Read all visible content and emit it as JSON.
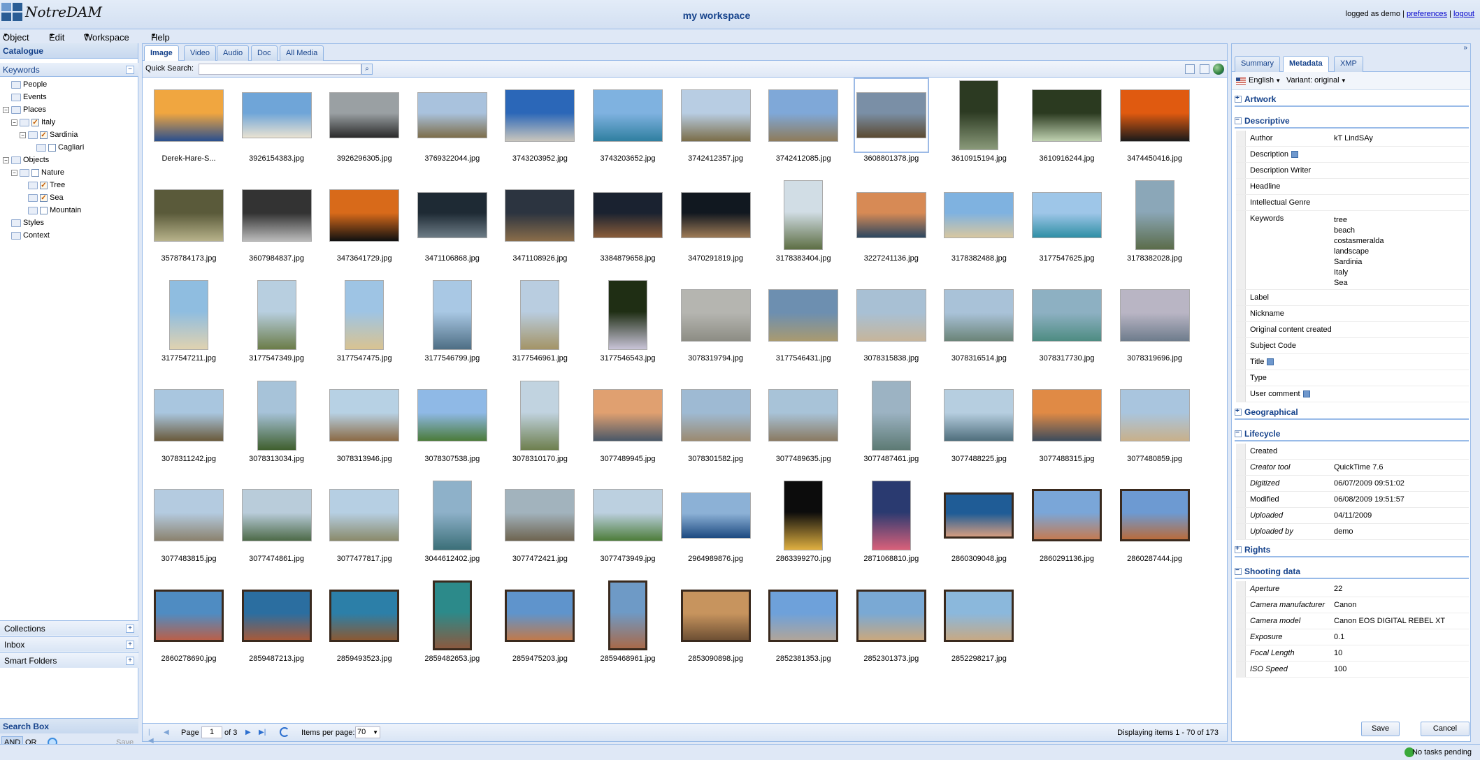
{
  "app": {
    "name": "NotreDAM",
    "workspace_title": "my workspace",
    "logged_as": "logged as demo",
    "preferences": "preferences",
    "logout": "logout",
    "sep": "|"
  },
  "menu": [
    "Object",
    "Edit",
    "Workspace",
    "Help"
  ],
  "catalogue": {
    "title": "Catalogue",
    "keywords": "Keywords",
    "tree": [
      {
        "label": "People",
        "level": 0,
        "toggle": "",
        "check": null
      },
      {
        "label": "Events",
        "level": 0,
        "toggle": "",
        "check": null
      },
      {
        "label": "Places",
        "level": 0,
        "toggle": "−",
        "check": null
      },
      {
        "label": "Italy",
        "level": 1,
        "toggle": "−",
        "check": true
      },
      {
        "label": "Sardinia",
        "level": 2,
        "toggle": "−",
        "check": true
      },
      {
        "label": "Cagliari",
        "level": 3,
        "toggle": "",
        "check": false
      },
      {
        "label": "Objects",
        "level": 0,
        "toggle": "−",
        "check": null
      },
      {
        "label": "Nature",
        "level": 1,
        "toggle": "−",
        "check": false
      },
      {
        "label": "Tree",
        "level": 2,
        "toggle": "",
        "check": true
      },
      {
        "label": "Sea",
        "level": 2,
        "toggle": "",
        "check": true
      },
      {
        "label": "Mountain",
        "level": 2,
        "toggle": "",
        "check": false
      },
      {
        "label": "Styles",
        "level": 0,
        "toggle": "",
        "check": null
      },
      {
        "label": "Context",
        "level": 0,
        "toggle": "",
        "check": null
      }
    ]
  },
  "accordions": [
    "Collections",
    "Inbox",
    "Smart Folders"
  ],
  "search_box": {
    "title": "Search Box",
    "and": "AND",
    "or": "OR",
    "save": "Save"
  },
  "media_tabs": [
    "Image",
    "Video",
    "Audio",
    "Doc",
    "All Media"
  ],
  "quick_search": {
    "label": "Quick Search:",
    "value": ""
  },
  "items": [
    {
      "n": "Derek-Hare-S...",
      "t": "w",
      "c": "#f0a640",
      "c2": "#2a4f8e"
    },
    {
      "n": "3926154383.jpg",
      "t": "w2",
      "c": "#6fa5d8",
      "c2": "#e9e2d2"
    },
    {
      "n": "3926296305.jpg",
      "t": "w2",
      "c": "#9aa0a3",
      "c2": "#2a2a2a"
    },
    {
      "n": "3769322044.jpg",
      "t": "w2",
      "c": "#a9c2dd",
      "c2": "#7d6d4a"
    },
    {
      "n": "3743203952.jpg",
      "t": "w",
      "c": "#2b67b8",
      "c2": "#c9c6bd"
    },
    {
      "n": "3743203652.jpg",
      "t": "w",
      "c": "#7fb2e0",
      "c2": "#2f7fa0"
    },
    {
      "n": "3742412357.jpg",
      "t": "w",
      "c": "#b8cde3",
      "c2": "#7b6d48"
    },
    {
      "n": "3742412085.jpg",
      "t": "w",
      "c": "#7fa8d8",
      "c2": "#8e7b5a"
    },
    {
      "n": "3608801378.jpg",
      "t": "w2",
      "c": "#7a8fa6",
      "c2": "#5b4a31"
    },
    {
      "n": "3610915194.jpg",
      "t": "p",
      "c": "#2c3a22",
      "c2": "#8a9a7a"
    },
    {
      "n": "3610916244.jpg",
      "t": "w",
      "c": "#2b3a20",
      "c2": "#bfd1b0"
    },
    {
      "n": "3474450416.jpg",
      "t": "w",
      "c": "#e05a10",
      "c2": "#1a1a1a"
    },
    {
      "n": "3578784173.jpg",
      "t": "w",
      "c": "#5a5a3a",
      "c2": "#b7b28a"
    },
    {
      "n": "3607984837.jpg",
      "t": "w",
      "c": "#333",
      "c2": "#bbb"
    },
    {
      "n": "3473641729.jpg",
      "t": "w",
      "c": "#d86a1a",
      "c2": "#101010"
    },
    {
      "n": "3471106868.jpg",
      "t": "w2",
      "c": "#1e2a34",
      "c2": "#6d7c86"
    },
    {
      "n": "3471108926.jpg",
      "t": "w",
      "c": "#2c3440",
      "c2": "#8a6d4a"
    },
    {
      "n": "3384879658.jpg",
      "t": "w2",
      "c": "#1a2230",
      "c2": "#8a5d3a"
    },
    {
      "n": "3470291819.jpg",
      "t": "w2",
      "c": "#111820",
      "c2": "#9e7b56"
    },
    {
      "n": "3178383404.jpg",
      "t": "p",
      "c": "#d1dde5",
      "c2": "#5d6e43"
    },
    {
      "n": "3227241136.jpg",
      "t": "w2",
      "c": "#d78a55",
      "c2": "#2b4660"
    },
    {
      "n": "3178382488.jpg",
      "t": "w2",
      "c": "#7fb2e0",
      "c2": "#d8c7a0"
    },
    {
      "n": "3177547625.jpg",
      "t": "w2",
      "c": "#9ec6e8",
      "c2": "#2f8fa5"
    },
    {
      "n": "3178382028.jpg",
      "t": "p",
      "c": "#8ba7b8",
      "c2": "#5b6c4a"
    },
    {
      "n": "3177547211.jpg",
      "t": "p",
      "c": "#8fbde0",
      "c2": "#e0d2b0"
    },
    {
      "n": "3177547349.jpg",
      "t": "p",
      "c": "#b8cfe0",
      "c2": "#6b7c48"
    },
    {
      "n": "3177547475.jpg",
      "t": "p",
      "c": "#9ec4e4",
      "c2": "#d9c391"
    },
    {
      "n": "3177546799.jpg",
      "t": "p",
      "c": "#a9c8e4",
      "c2": "#4e6e84"
    },
    {
      "n": "3177546961.jpg",
      "t": "p",
      "c": "#b9cde0",
      "c2": "#a49466"
    },
    {
      "n": "3177546543.jpg",
      "t": "p",
      "c": "#1f2e14",
      "c2": "#c9c4d8"
    },
    {
      "n": "3078319794.jpg",
      "t": "w",
      "c": "#b5b5b0",
      "c2": "#8d8d84"
    },
    {
      "n": "3177546431.jpg",
      "t": "w",
      "c": "#6d8fb0",
      "c2": "#a99a70"
    },
    {
      "n": "3078315838.jpg",
      "t": "w",
      "c": "#a8c0d4",
      "c2": "#c6b59b"
    },
    {
      "n": "3078316514.jpg",
      "t": "w",
      "c": "#a9c2d8",
      "c2": "#6b8478"
    },
    {
      "n": "3078317730.jpg",
      "t": "w",
      "c": "#8db0c2",
      "c2": "#4e8c82"
    },
    {
      "n": "3078319696.jpg",
      "t": "w",
      "c": "#b9b5c4",
      "c2": "#6e7c8c"
    },
    {
      "n": "3078311242.jpg",
      "t": "w",
      "c": "#a9c6df",
      "c2": "#6a5a3c"
    },
    {
      "n": "3078313034.jpg",
      "t": "p",
      "c": "#a7c3d9",
      "c2": "#3f5f2e"
    },
    {
      "n": "3078313946.jpg",
      "t": "w",
      "c": "#b7d1e4",
      "c2": "#8b6a45"
    },
    {
      "n": "3078307538.jpg",
      "t": "w",
      "c": "#8fb9e6",
      "c2": "#4b7b3a"
    },
    {
      "n": "3078310170.jpg",
      "t": "p",
      "c": "#c1d3e0",
      "c2": "#6e7f4e"
    },
    {
      "n": "3077489945.jpg",
      "t": "w",
      "c": "#e0a070",
      "c2": "#4a5868"
    },
    {
      "n": "3078301582.jpg",
      "t": "w",
      "c": "#9ebad3",
      "c2": "#9b8a70"
    },
    {
      "n": "3077489635.jpg",
      "t": "w",
      "c": "#a8c3d8",
      "c2": "#8a7a62"
    },
    {
      "n": "3077487461.jpg",
      "t": "p",
      "c": "#9cb3c3",
      "c2": "#5d7a74"
    },
    {
      "n": "3077488225.jpg",
      "t": "w",
      "c": "#b6cee0",
      "c2": "#4f6e7c"
    },
    {
      "n": "3077488315.jpg",
      "t": "w",
      "c": "#e08a45",
      "c2": "#3d4c5c"
    },
    {
      "n": "3077480859.jpg",
      "t": "w",
      "c": "#a9c5de",
      "c2": "#c8b08a"
    },
    {
      "n": "3077483815.jpg",
      "t": "w",
      "c": "#b4cbe0",
      "c2": "#8b826e"
    },
    {
      "n": "3077474861.jpg",
      "t": "w",
      "c": "#b9ccda",
      "c2": "#4d6a48"
    },
    {
      "n": "3077477817.jpg",
      "t": "w",
      "c": "#b6cfe3",
      "c2": "#8a8a6a"
    },
    {
      "n": "3044612402.jpg",
      "t": "p",
      "c": "#8eb1c9",
      "c2": "#3b6f78"
    },
    {
      "n": "3077472421.jpg",
      "t": "w",
      "c": "#a2b3bd",
      "c2": "#6e6450"
    },
    {
      "n": "3077473949.jpg",
      "t": "w",
      "c": "#bcd0e0",
      "c2": "#4d7d3a"
    },
    {
      "n": "2964989876.jpg",
      "t": "w2",
      "c": "#8cb1d6",
      "c2": "#1d4a80"
    },
    {
      "n": "2863399270.jpg",
      "t": "p",
      "c": "#0c0c0c",
      "c2": "#e0b040"
    },
    {
      "n": "2871068810.jpg",
      "t": "p",
      "c": "#2a3a70",
      "c2": "#d9607a"
    },
    {
      "n": "2860309048.jpg",
      "t": "w2",
      "c": "#1f5c96",
      "c2": "#d49d80",
      "frame": true
    },
    {
      "n": "2860291136.jpg",
      "t": "w",
      "c": "#7aa6d8",
      "c2": "#c47b52",
      "frame": true
    },
    {
      "n": "2860287444.jpg",
      "t": "w",
      "c": "#6d9ad2",
      "c2": "#b96c3c",
      "frame": true
    },
    {
      "n": "2860278690.jpg",
      "t": "w",
      "c": "#4f8cc2",
      "c2": "#b9604a",
      "frame": true
    },
    {
      "n": "2859487213.jpg",
      "t": "w",
      "c": "#2b6ea0",
      "c2": "#a65a3a",
      "frame": true
    },
    {
      "n": "2859493523.jpg",
      "t": "w",
      "c": "#2c7fa8",
      "c2": "#8a5a34",
      "frame": true
    },
    {
      "n": "2859482653.jpg",
      "t": "p",
      "c": "#2c8a8a",
      "c2": "#8a5a40",
      "frame": true
    },
    {
      "n": "2859475203.jpg",
      "t": "w",
      "c": "#5f94cc",
      "c2": "#c07a4c",
      "frame": true
    },
    {
      "n": "2859468961.jpg",
      "t": "p",
      "c": "#6e9ac6",
      "c2": "#a86a4a",
      "frame": true
    },
    {
      "n": "2853090898.jpg",
      "t": "w",
      "c": "#c7945e",
      "c2": "#6e5034",
      "frame": true
    },
    {
      "n": "2852381353.jpg",
      "t": "w",
      "c": "#6ea1da",
      "c2": "#b0a59a",
      "frame": true
    },
    {
      "n": "2852301373.jpg",
      "t": "w",
      "c": "#7aa9d4",
      "c2": "#c9a87e",
      "frame": true
    },
    {
      "n": "2852298217.jpg",
      "t": "w",
      "c": "#8bb8dc",
      "c2": "#c6a985",
      "frame": true
    }
  ],
  "selected_index": 8,
  "pager": {
    "page_label": "Page",
    "page": "1",
    "of": "of 3",
    "items_per_page": "Items per page:",
    "ipp": "70",
    "displaying": "Displaying items 1 - 70 of 173"
  },
  "right_tabs": [
    "Summary",
    "Metadata",
    "XMP"
  ],
  "right_active": 1,
  "lang": {
    "language": "English",
    "variant": "Variant: original"
  },
  "metadata": {
    "artwork": "Artwork",
    "descriptive": "Descriptive",
    "desc_rows": [
      {
        "k": "Author",
        "v": "kT LindSAy"
      },
      {
        "k": "Description",
        "v": "",
        "info": true
      },
      {
        "k": "Description Writer",
        "v": ""
      },
      {
        "k": "Headline",
        "v": ""
      },
      {
        "k": "Intellectual Genre",
        "v": ""
      }
    ],
    "keywords_label": "Keywords",
    "keywords": [
      "tree",
      "beach",
      "costasmeralda",
      "landscape",
      "Sardinia",
      "Italy",
      "Sea"
    ],
    "desc_rows2": [
      {
        "k": "Label",
        "v": ""
      },
      {
        "k": "Nickname",
        "v": ""
      },
      {
        "k": "Original content created",
        "v": ""
      },
      {
        "k": "Subject Code",
        "v": ""
      },
      {
        "k": "Title",
        "v": "",
        "info": true
      },
      {
        "k": "Type",
        "v": ""
      },
      {
        "k": "User comment",
        "v": "",
        "info": true
      }
    ],
    "geographical": "Geographical",
    "lifecycle": "Lifecycle",
    "life_rows": [
      {
        "k": "Created",
        "v": "",
        "it": false
      },
      {
        "k": "Creator tool",
        "v": "QuickTime 7.6",
        "it": true
      },
      {
        "k": "Digitized",
        "v": "06/07/2009 09:51:02",
        "it": true
      },
      {
        "k": "Modified",
        "v": "06/08/2009 19:51:57",
        "it": false
      },
      {
        "k": "Uploaded",
        "v": "04/11/2009",
        "it": true
      },
      {
        "k": "Uploaded by",
        "v": "demo",
        "it": true
      }
    ],
    "rights": "Rights",
    "shooting": "Shooting data",
    "shoot_rows": [
      {
        "k": "Aperture",
        "v": "22"
      },
      {
        "k": "Camera manufacturer",
        "v": "Canon"
      },
      {
        "k": "Camera model",
        "v": "Canon EOS DIGITAL REBEL XT"
      },
      {
        "k": "Exposure",
        "v": "0.1"
      },
      {
        "k": "Focal Length",
        "v": "10"
      },
      {
        "k": "ISO Speed",
        "v": "100"
      }
    ]
  },
  "buttons": {
    "save": "Save",
    "cancel": "Cancel"
  },
  "status": "No tasks pending"
}
